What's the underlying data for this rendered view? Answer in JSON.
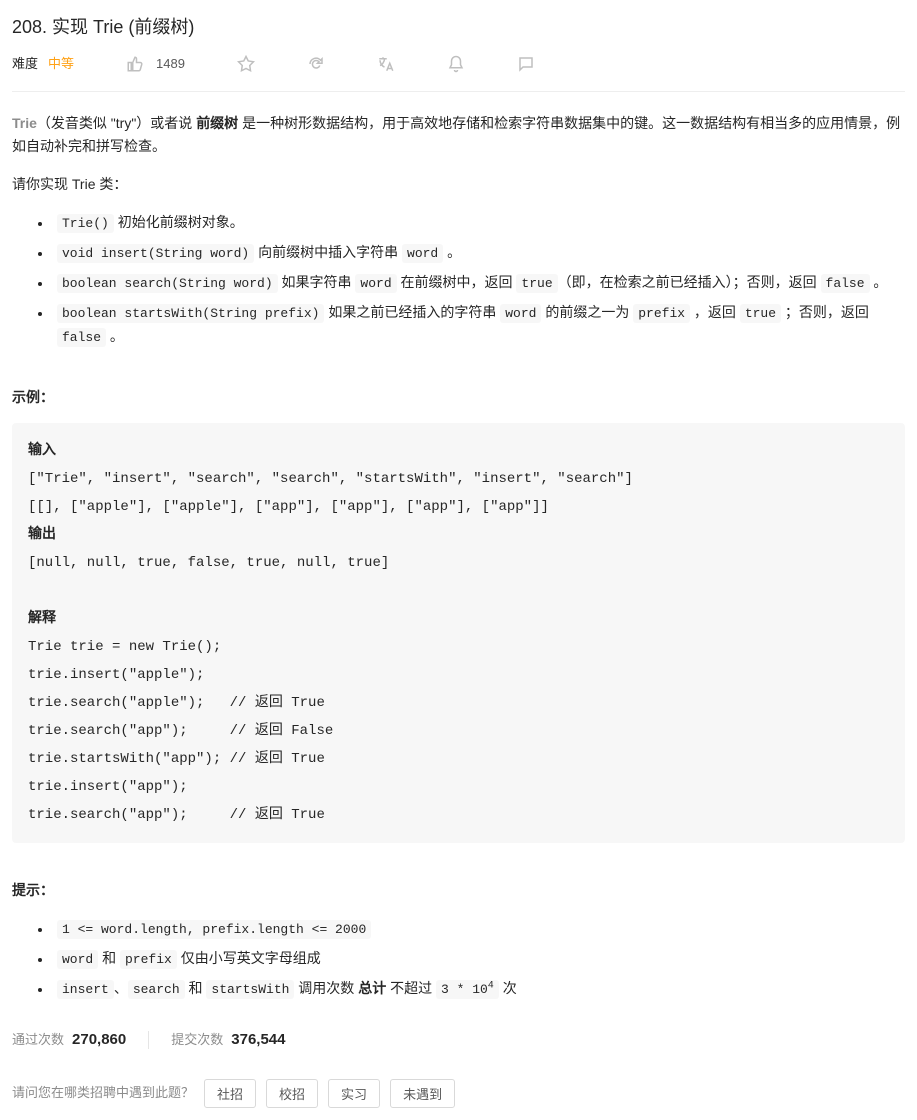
{
  "title": "208. 实现 Trie (前缀树)",
  "meta": {
    "difficulty_label": "难度",
    "difficulty_value": "中等",
    "likes": "1489"
  },
  "desc": {
    "trie_word": "Trie",
    "intro_part1": "（发音类似 \"try\"）或者说 ",
    "bold1": "前缀树",
    "intro_part2": " 是一种树形数据结构，用于高效地存储和检索字符串数据集中的键。这一数据结构有相当多的应用情景，例如自动补完和拼写检查。",
    "please": "请你实现 Trie 类："
  },
  "bullets": {
    "b1_code": "Trie()",
    "b1_text": " 初始化前缀树对象。",
    "b2_code": "void insert(String word)",
    "b2_text1": " 向前缀树中插入字符串 ",
    "b2_code2": "word",
    "b2_text2": " 。",
    "b3_code": "boolean search(String word)",
    "b3_text1": " 如果字符串 ",
    "b3_code2": "word",
    "b3_text2": " 在前缀树中，返回 ",
    "b3_code3": "true",
    "b3_text3": "（即，在检索之前已经插入）；否则，返回 ",
    "b3_code4": "false",
    "b3_text4": " 。",
    "b4_code": "boolean startsWith(String prefix)",
    "b4_text1": " 如果之前已经插入的字符串 ",
    "b4_code2": "word",
    "b4_text2": " 的前缀之一为 ",
    "b4_code3": "prefix",
    "b4_text3": " ，返回 ",
    "b4_code4": "true",
    "b4_text4": " ；否则，返回 ",
    "b4_code5": "false",
    "b4_text5": " 。"
  },
  "example_head": "示例：",
  "example": {
    "input_label": "输入",
    "input_line1": "[\"Trie\", \"insert\", \"search\", \"search\", \"startsWith\", \"insert\", \"search\"]",
    "input_line2": "[[], [\"apple\"], [\"apple\"], [\"app\"], [\"app\"], [\"app\"], [\"app\"]]",
    "output_label": "输出",
    "output_line": "[null, null, true, false, true, null, true]",
    "explain_label": "解释",
    "e1": "Trie trie = new Trie();",
    "e2": "trie.insert(\"apple\");",
    "e3": "trie.search(\"apple\");   // 返回 True",
    "e4": "trie.search(\"app\");     // 返回 False",
    "e5": "trie.startsWith(\"app\"); // 返回 True",
    "e6": "trie.insert(\"app\");",
    "e7": "trie.search(\"app\");     // 返回 True"
  },
  "hints_head": "提示：",
  "hints": {
    "h1": "1 <= word.length, prefix.length <= 2000",
    "h2_code1": "word",
    "h2_text1": " 和 ",
    "h2_code2": "prefix",
    "h2_text2": " 仅由小写英文字母组成",
    "h3_code1": "insert",
    "h3_text1": "、",
    "h3_code2": "search",
    "h3_text2": " 和 ",
    "h3_code3": "startsWith",
    "h3_text3": " 调用次数 ",
    "h3_bold": "总计",
    "h3_text4": " 不超过 ",
    "h3_code4_a": "3 * 10",
    "h3_code4_b": "4",
    "h3_text5": " 次"
  },
  "stats": {
    "pass_label": "通过次数",
    "pass_value": "270,860",
    "submit_label": "提交次数",
    "submit_value": "376,544"
  },
  "question": {
    "text": "请问您在哪类招聘中遇到此题？",
    "opt1": "社招",
    "opt2": "校招",
    "opt3": "实习",
    "opt4": "未遇到"
  }
}
